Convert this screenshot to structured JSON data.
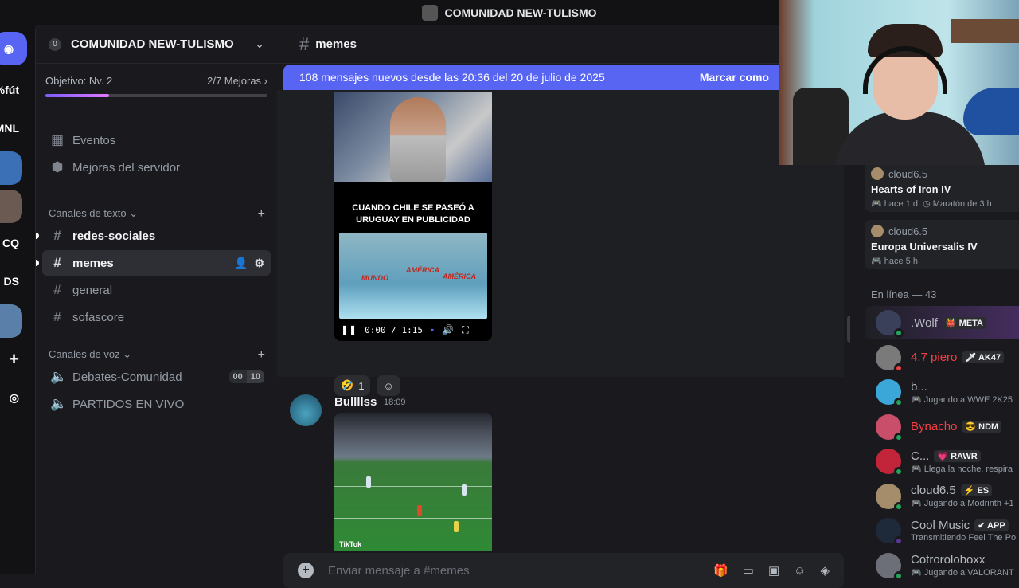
{
  "window": {
    "title": "COMUNIDAD NEW-TULISMO"
  },
  "server_rail": {
    "items": [
      {
        "label": ""
      },
      {
        "label": "%fút"
      },
      {
        "label": "MNL"
      },
      {
        "label": ""
      },
      {
        "label": ""
      },
      {
        "label": "CQ"
      },
      {
        "label": "DS"
      },
      {
        "label": ""
      },
      {
        "label": "+"
      }
    ]
  },
  "sidebar": {
    "server_name": "COMUNIDAD NEW-TULISMO",
    "server_badge": "0",
    "boost": {
      "goal": "Objetivo: Nv. 2",
      "progress_label": "2/7 Mejoras",
      "progress": 0.2857
    },
    "nav": [
      {
        "label": "Eventos",
        "icon": "calendar-icon"
      },
      {
        "label": "Mejoras del servidor",
        "icon": "boost-shield-icon"
      }
    ],
    "text_category": "Canales de texto",
    "text_channels": [
      {
        "label": "redes-sociales",
        "unread": true
      },
      {
        "label": "memes",
        "active": true
      },
      {
        "label": "general"
      },
      {
        "label": "sofascore"
      }
    ],
    "voice_category": "Canales de voz",
    "voice_channels": [
      {
        "label": "Debates-Comunidad",
        "count_a": "00",
        "count_b": "10"
      },
      {
        "label": "PARTIDOS EN VIVO"
      }
    ]
  },
  "channel": {
    "name": "memes",
    "new_messages_banner": "108 mensajes nuevos desde las 20:36 del 20 de julio de 2025",
    "mark_read": "Marcar como",
    "video": {
      "caption_line1": "CUANDO CHILE SE PASEÓ A",
      "caption_line2": "URUGUAY EN PUBLICIDAD",
      "glass_words": [
        "MUNDO",
        "AMÉRICA",
        "AMÉRICA"
      ],
      "time": "0:00 / 1:15"
    },
    "reaction": {
      "emoji": "🤣",
      "count": "1"
    },
    "message2": {
      "author": "Bullllss",
      "time": "18:09",
      "watermark": "TikTok"
    },
    "composer_placeholder": "Enviar mensaje a #memes"
  },
  "members": {
    "activities": [
      {
        "user": "cloud6.5",
        "game": "Hearts of Iron IV",
        "ago": "hace 1 d",
        "extra": "Maratón de 3 h"
      },
      {
        "user": "cloud6.5",
        "game": "Europa Universalis IV",
        "ago": "hace 5 h"
      }
    ],
    "online_header": "En línea — 43",
    "list": [
      {
        "name": ".Wolf",
        "tag": "👹 META",
        "sub": "",
        "status": "#23a55a",
        "color": "#b5bac1",
        "avatar": "#3a3f5a"
      },
      {
        "name": "4.7 piero",
        "tag": "🗡 AK47",
        "sub": "",
        "status": "#f23f43",
        "color": "#f23f43",
        "avatar": "#7a7a7a"
      },
      {
        "name": "b...",
        "tag": "",
        "sub": "🎮 Jugando a WWE 2K25",
        "status": "#23a55a",
        "color": "#b5bac1",
        "avatar": "#3aa7d8"
      },
      {
        "name": "Bynacho",
        "tag": "😎 NDM",
        "sub": "",
        "status": "#23a55a",
        "color": "#f23f43",
        "avatar": "#c94e6a"
      },
      {
        "name": "C...",
        "tag": "💗 RAWR",
        "sub": "🎮 Llega la noche, respira",
        "status": "#23a55a",
        "color": "#b5bac1",
        "avatar": "#c2243a"
      },
      {
        "name": "cloud6.5",
        "tag": "⚡ ES",
        "sub": "🎮 Jugando a Modrinth +1",
        "status": "#23a55a",
        "color": "#b5bac1",
        "avatar": "#a58c6a"
      },
      {
        "name": "Cool Music",
        "tag": "✔ APP",
        "sub": "Transmitiendo Feel The Po",
        "status": "#593695",
        "color": "#b5bac1",
        "avatar": "#1e2a3a"
      },
      {
        "name": "Cotroroloboxx",
        "tag": "",
        "sub": "🎮 Jugando a VALORANT",
        "status": "#23a55a",
        "color": "#b5bac1",
        "avatar": "#6d6f78"
      }
    ]
  },
  "colors": {
    "blurple": "#5865f2",
    "online": "#23a55a",
    "dnd": "#f23f43",
    "bg": "#1a1a1e"
  }
}
